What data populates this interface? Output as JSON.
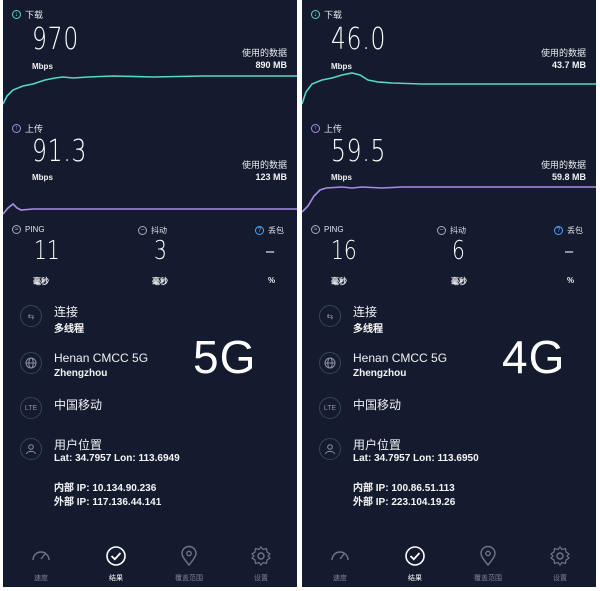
{
  "panels": [
    {
      "id": "left",
      "download": {
        "label": "下载",
        "value": "970",
        "unit": "Mbps",
        "data_label": "使用的数据",
        "data_value": "890 MB"
      },
      "upload": {
        "label": "上传",
        "value": "91.3",
        "unit": "Mbps",
        "data_label": "使用的数据",
        "data_value": "123 MB"
      },
      "ping": {
        "label": "PING",
        "value": "11",
        "unit": "毫秒"
      },
      "jitter": {
        "label": "抖动",
        "value": "3",
        "unit": "毫秒"
      },
      "loss": {
        "label": "丢包",
        "value": "–",
        "unit": "%"
      },
      "connection": {
        "title": "连接",
        "value": "多线程"
      },
      "server": {
        "title": "Henan CMCC 5G",
        "value": "Zhengzhou"
      },
      "carrier": {
        "icon_text": "LTE",
        "title": "中国移动"
      },
      "location": {
        "title": "用户位置",
        "coords": "Lat: 34.7957 Lon: 113.6949",
        "internal_ip": "内部 IP: 10.134.90.236",
        "external_ip": "外部 IP: 117.136.44.141"
      },
      "badge": "5G"
    },
    {
      "id": "right",
      "download": {
        "label": "下载",
        "value": "46.0",
        "unit": "Mbps",
        "data_label": "使用的数据",
        "data_value": "43.7 MB"
      },
      "upload": {
        "label": "上传",
        "value": "59.5",
        "unit": "Mbps",
        "data_label": "使用的数据",
        "data_value": "59.8 MB"
      },
      "ping": {
        "label": "PING",
        "value": "16",
        "unit": "毫秒"
      },
      "jitter": {
        "label": "抖动",
        "value": "6",
        "unit": "毫秒"
      },
      "loss": {
        "label": "丢包",
        "value": "–",
        "unit": "%"
      },
      "connection": {
        "title": "连接",
        "value": "多线程"
      },
      "server": {
        "title": "Henan CMCC 5G",
        "value": "Zhengzhou"
      },
      "carrier": {
        "icon_text": "LTE",
        "title": "中国移动"
      },
      "location": {
        "title": "用户位置",
        "coords": "Lat: 34.7957 Lon: 113.6950",
        "internal_ip": "内部 IP: 100.86.51.113",
        "external_ip": "外部 IP: 223.104.19.26"
      },
      "badge": "4G"
    }
  ],
  "nav": {
    "speed": "速度",
    "results": "结果",
    "coverage": "覆盖范围",
    "settings": "设置",
    "active": "results"
  },
  "colors": {
    "background": "#151b2e",
    "download_line": "#56d7c7",
    "upload_line": "#a98be8",
    "info_blue": "#4aa8ff"
  },
  "icons": {
    "download": "arrow-down-circle-icon",
    "upload": "arrow-up-circle-icon",
    "jitter": "minus-circle-icon",
    "loss": "question-circle-icon",
    "connection": "arrows-icon",
    "server": "globe-icon",
    "carrier": "lte-icon",
    "location": "person-icon"
  }
}
